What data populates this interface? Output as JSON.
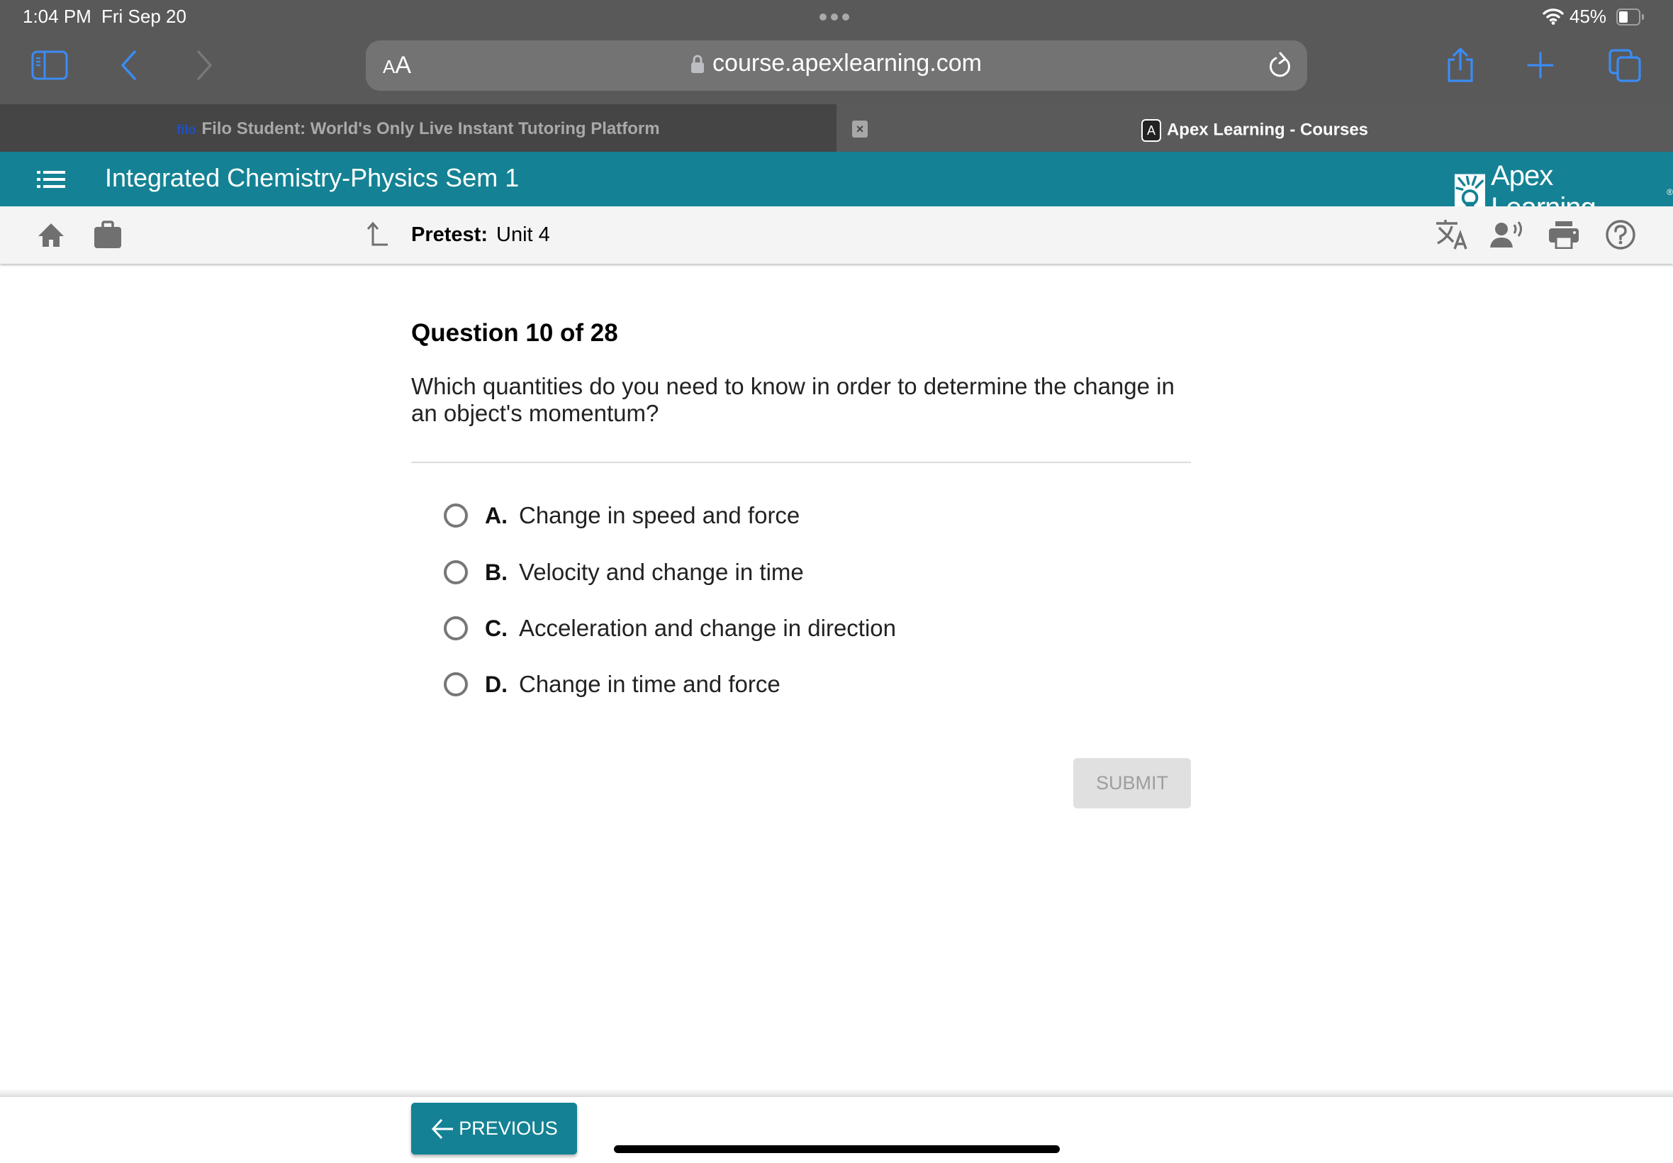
{
  "status_bar": {
    "time": "1:04 PM",
    "date": "Fri Sep 20",
    "battery_percent": "45%",
    "battery_level": 0.45
  },
  "safari": {
    "text_size_button": {
      "small": "A",
      "large": "A"
    },
    "url": "course.apexlearning.com",
    "icons": [
      "sidebar-icon",
      "back-icon",
      "forward-icon",
      "lock-icon",
      "reload-icon",
      "share-icon",
      "new-tab-icon",
      "tabs-overview-icon"
    ]
  },
  "tabs": [
    {
      "favicon": "filo",
      "label": "Filo Student: World's Only Live Instant Tutoring Platform",
      "active": false
    },
    {
      "favicon": "A",
      "label": "Apex Learning - Courses",
      "active": true
    }
  ],
  "tab_close_symbol": "×",
  "app_header": {
    "course_title": "Integrated Chemistry-Physics Sem 1",
    "brand": "Apex Learning",
    "brand_mark": "®"
  },
  "subbar": {
    "activity_type": "Pretest:",
    "activity_name": "Unit 4"
  },
  "question": {
    "title": "Question 10 of 28",
    "prompt": "Which quantities do you need to know in order to determine the change in an object's momentum?",
    "options": [
      {
        "letter": "A.",
        "text": "Change in speed and force",
        "selected": false
      },
      {
        "letter": "B.",
        "text": "Velocity and change in time",
        "selected": false
      },
      {
        "letter": "C.",
        "text": "Acceleration and change in direction",
        "selected": false
      },
      {
        "letter": "D.",
        "text": "Change in time and force",
        "selected": false
      }
    ],
    "submit_label": "SUBMIT",
    "submit_enabled": false
  },
  "footer": {
    "previous_label": "PREVIOUS"
  },
  "colors": {
    "brand_teal": "#148294",
    "safari_accent": "#3b8cf5",
    "chrome_gray": "#595959"
  }
}
